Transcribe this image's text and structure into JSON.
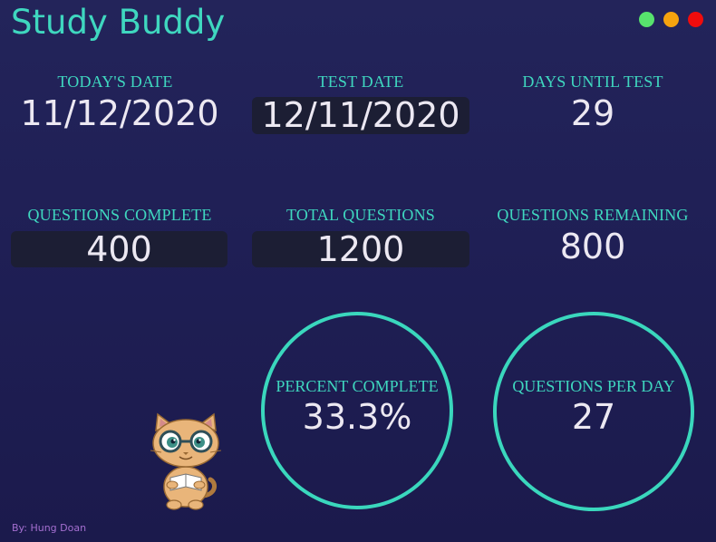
{
  "app": {
    "title": "Study Buddy",
    "accent_color": "#3fd7bf",
    "window_controls": [
      "minimize-green",
      "maximize-orange",
      "close-red"
    ]
  },
  "dates": {
    "today_label": "TODAY'S DATE",
    "today_value": "11/12/2020",
    "test_label": "TEST DATE",
    "test_value": "12/11/2020",
    "days_label": "DAYS UNTIL TEST",
    "days_value": "29"
  },
  "questions": {
    "complete_label": "QUESTIONS COMPLETE",
    "complete_value": "400",
    "total_label": "TOTAL QUESTIONS",
    "total_value": "1200",
    "remaining_label": "QUESTIONS REMAINING",
    "remaining_value": "800"
  },
  "stats": {
    "percent_label": "PERCENT COMPLETE",
    "percent_value": "33.3%",
    "per_day_label": "QUESTIONS PER DAY",
    "per_day_value": "27"
  },
  "mascot": {
    "icon": "reading-cat-with-glasses-icon"
  },
  "footer": {
    "author": "By: Hung Doan"
  }
}
